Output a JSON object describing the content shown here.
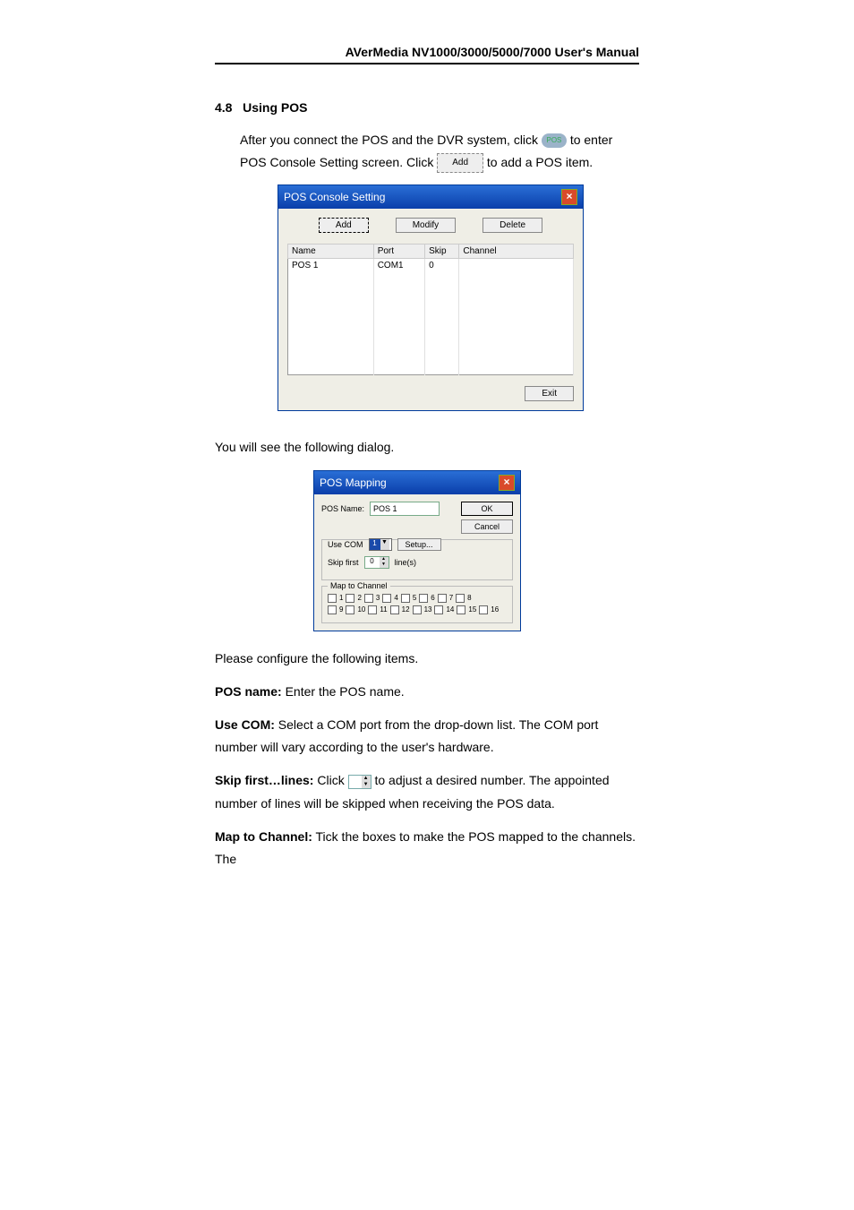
{
  "header": "AVerMedia NV1000/3000/5000/7000 User's Manual",
  "section": {
    "num": "4.8",
    "title": "Using POS"
  },
  "intro1a": "After you connect the POS and the DVR system, click ",
  "intro1b": " to enter POS Console Setting screen. Click ",
  "intro1c": " to add a POS item.",
  "posIconLabel": "POS",
  "addIconLabel": "Add",
  "dialog1": {
    "title": "POS Console Setting",
    "buttons": {
      "add": "Add",
      "modify": "Modify",
      "delete": "Delete",
      "exit": "Exit"
    },
    "cols": {
      "name": "Name",
      "port": "Port",
      "skip": "Skip",
      "channel": "Channel"
    },
    "row": {
      "name": "POS 1",
      "port": "COM1",
      "skip": "0",
      "channel": ""
    }
  },
  "midText": "You will see the following dialog.",
  "dialog2": {
    "title": "POS Mapping",
    "posNameLabel": "POS Name:",
    "posNameValue": "POS 1",
    "ok": "OK",
    "cancel": "Cancel",
    "useCom": "Use COM",
    "comValue": "1",
    "setup": "Setup...",
    "skipFirst": "Skip first",
    "skipValue": "0",
    "lines": "line(s)",
    "mapLegend": "Map to Channel",
    "ch": [
      "1",
      "2",
      "3",
      "4",
      "5",
      "6",
      "7",
      "8",
      "9",
      "10",
      "11",
      "12",
      "13",
      "14",
      "15",
      "16"
    ]
  },
  "configIntro": "Please configure the following items.",
  "items": {
    "posName": {
      "label": "POS name:",
      "text": " Enter the POS name."
    },
    "useCom": {
      "label": "Use COM:",
      "text": " Select a COM port from the drop-down list. The COM port number will vary according to the user's hardware."
    },
    "skip": {
      "label": "Skip first…lines:",
      "t1": " Click ",
      "t2": " to adjust a desired number. The appointed number of lines will be skipped when receiving the POS data."
    },
    "map": {
      "label": "Map to Channel:",
      "text": " Tick the boxes to make the POS mapped to the channels. The"
    }
  }
}
